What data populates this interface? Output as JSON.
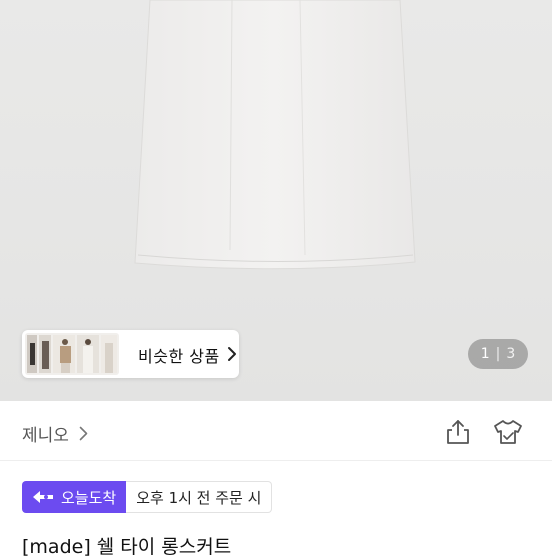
{
  "gallery": {
    "similar_label": "비슷한 상품",
    "page_current": "1",
    "page_separator": "|",
    "page_total": "3"
  },
  "seller": {
    "name": "제니오"
  },
  "delivery": {
    "badge_label": "오늘도착",
    "condition": "오후 1시 전 주문 시"
  },
  "product": {
    "title": "[made] 쉘 타이 롱스커트"
  },
  "colors": {
    "accent": "#6c4bf0"
  }
}
